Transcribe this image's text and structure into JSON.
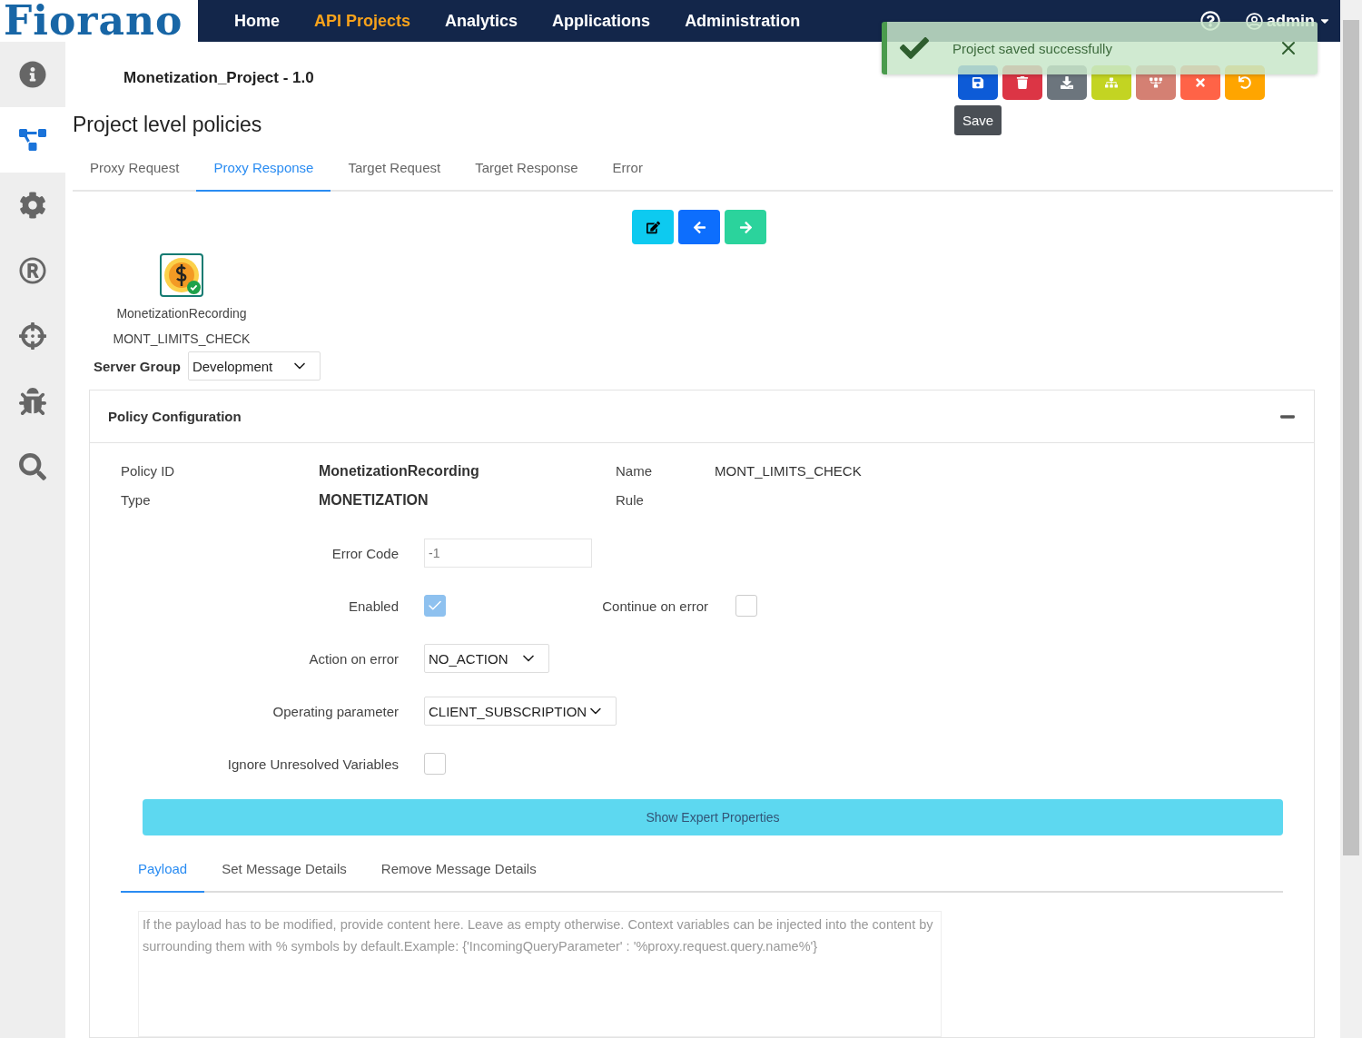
{
  "header": {
    "logo": "Fiorano",
    "nav": [
      {
        "label": "Home",
        "selected": false
      },
      {
        "label": "API Projects",
        "selected": true
      },
      {
        "label": "Analytics",
        "selected": false
      },
      {
        "label": "Applications",
        "selected": false
      },
      {
        "label": "Administration",
        "selected": false
      }
    ],
    "user": "admin"
  },
  "sidebar": {
    "items": [
      {
        "kind": "info",
        "selected": false
      },
      {
        "kind": "diagram",
        "selected": true
      },
      {
        "kind": "gear",
        "selected": false
      },
      {
        "kind": "registered",
        "selected": false
      },
      {
        "kind": "crosshairs",
        "selected": false
      },
      {
        "kind": "bug",
        "selected": false
      },
      {
        "kind": "search",
        "selected": false
      }
    ]
  },
  "project_title": "Monetization_Project - 1.0",
  "toolbar": {
    "buttons": [
      {
        "kind": "save",
        "color": "#0d5bd7"
      },
      {
        "kind": "delete",
        "color": "#dc3545"
      },
      {
        "kind": "download",
        "color": "#6c757d"
      },
      {
        "kind": "tree",
        "color": "#c3d422"
      },
      {
        "kind": "fork",
        "color": "#d48073"
      },
      {
        "kind": "close",
        "color": "#ff6347"
      },
      {
        "kind": "undo",
        "color": "#ffa500"
      }
    ],
    "tooltip": "Save"
  },
  "toast": {
    "message": "Project saved successfully"
  },
  "heading": "Project level policies",
  "tabs": [
    {
      "label": "Proxy Request",
      "selected": false
    },
    {
      "label": "Proxy Response",
      "selected": true
    },
    {
      "label": "Target Request",
      "selected": false
    },
    {
      "label": "Target Response",
      "selected": false
    },
    {
      "label": "Error",
      "selected": false
    }
  ],
  "actions": [
    {
      "kind": "edit",
      "color": "#0dcaf0"
    },
    {
      "kind": "back",
      "color": "#0d6efd"
    },
    {
      "kind": "forward",
      "color": "#2bd39c"
    }
  ],
  "policy": {
    "name": "MonetizationRecording",
    "id": "MONT_LIMITS_CHECK"
  },
  "server_group": {
    "label": "Server Group",
    "value": "Development"
  },
  "panel": {
    "title": "Policy Configuration",
    "expanded": true,
    "info": [
      {
        "label": "Policy ID",
        "value": "MonetizationRecording"
      },
      {
        "label": "Name",
        "value": "MONT_LIMITS_CHECK"
      },
      {
        "label": "Type",
        "value": "MONETIZATION"
      },
      {
        "label": "Rule"
      }
    ],
    "error_code": {
      "label": "Error Code",
      "placeholder": "-1"
    },
    "enabled": {
      "label": "Enabled",
      "checked": true
    },
    "continue_on_error": {
      "label": "Continue on error",
      "checked": false
    },
    "action_on_error": {
      "label": "Action on error",
      "value": "NO_ACTION"
    },
    "operating_parameter": {
      "label": "Operating parameter",
      "value": "CLIENT_SUBSCRIPTION"
    },
    "ignore_unresolved": {
      "label": "Ignore Unresolved Variables",
      "checked": false
    },
    "expert_button": "Show Expert Properties",
    "subtabs": [
      {
        "label": "Payload",
        "selected": true
      },
      {
        "label": "Set Message Details",
        "selected": false
      },
      {
        "label": "Remove Message Details",
        "selected": false
      }
    ],
    "payload": {
      "placeholder": "If the payload has to be modified, provide content here. Leave as empty otherwise. Context variables can be injected into the content by surrounding them with % symbols by default.Example: {'IncomingQueryParameter' : '%proxy.request.query.name%'}"
    }
  }
}
